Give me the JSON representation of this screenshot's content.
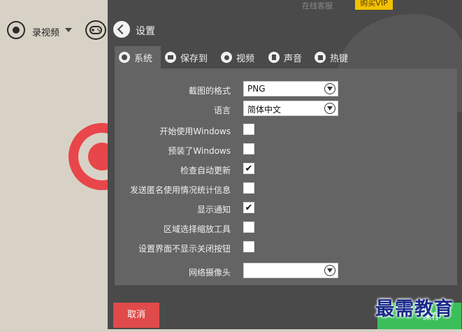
{
  "left_app": {
    "record_label": "录视频"
  },
  "top": {
    "online_service": "在线客服",
    "vip_button": "购买VIP"
  },
  "header": {
    "title": "设置"
  },
  "tabs": [
    {
      "label": "系统",
      "icon": "gear-icon",
      "active": true
    },
    {
      "label": "保存到",
      "icon": "folder-icon",
      "active": false
    },
    {
      "label": "视频",
      "icon": "record-icon",
      "active": false
    },
    {
      "label": "声音",
      "icon": "speaker-icon",
      "active": false
    },
    {
      "label": "热键",
      "icon": "hotkey-icon",
      "active": false
    }
  ],
  "settings": {
    "screenshot_format": {
      "label": "截图的格式",
      "value": "PNG"
    },
    "language": {
      "label": "语言",
      "value": "简体中文"
    },
    "start_with_windows": {
      "label": "开始使用Windows",
      "checked": false
    },
    "preinstalled_windows": {
      "label": "预装了Windows",
      "checked": false
    },
    "auto_update": {
      "label": "检查自动更新",
      "checked": true,
      "mark": "✔"
    },
    "anonymous_stats": {
      "label": "发送匿名使用情况统计信息",
      "checked": false
    },
    "show_notifications": {
      "label": "显示通知",
      "checked": true,
      "mark": "✔"
    },
    "region_zoom_tool": {
      "label": "区域选择缩放工具",
      "checked": false
    },
    "hide_close_button": {
      "label": "设置界面不显示关闭按钮",
      "checked": false
    },
    "webcam": {
      "label": "网络摄像头",
      "value": ""
    }
  },
  "footer": {
    "cancel_label": "取消",
    "save_label": "保存"
  },
  "watermark": "最需教育",
  "colors": {
    "accent_red": "#e04a4a",
    "accent_green": "#3cbf5a",
    "vip_yellow": "#f2c200"
  }
}
